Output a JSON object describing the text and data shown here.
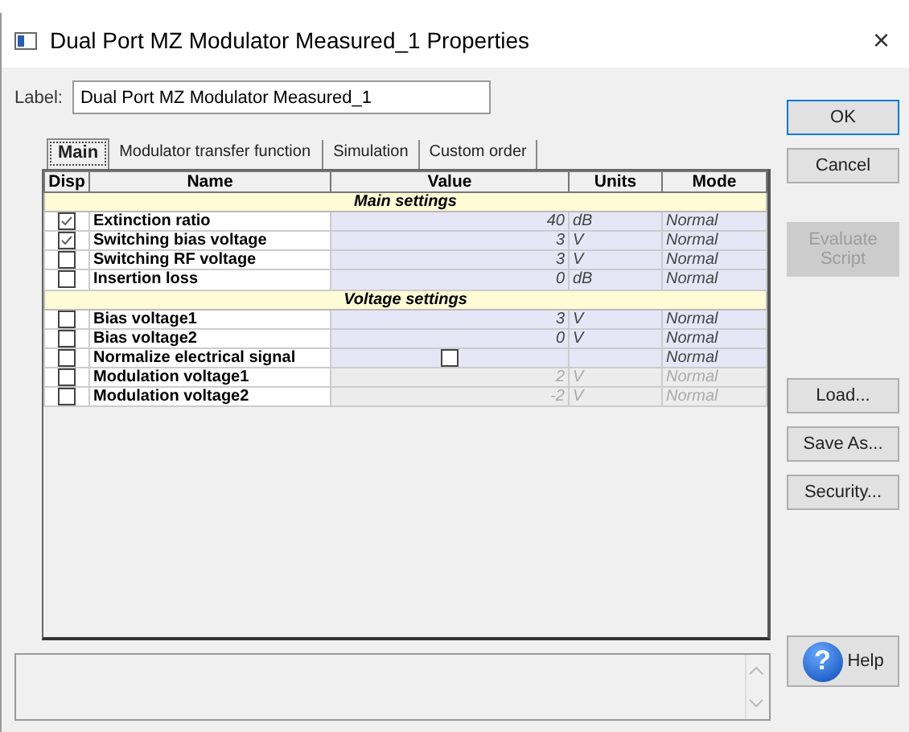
{
  "window": {
    "title": "Dual Port MZ Modulator Measured_1 Properties",
    "close": "×"
  },
  "label": {
    "caption": "Label:",
    "value": "Dual Port MZ Modulator Measured_1"
  },
  "tabs": [
    {
      "label": "Main",
      "selected": true
    },
    {
      "label": "Modulator transfer function",
      "selected": false
    },
    {
      "label": "Simulation",
      "selected": false
    },
    {
      "label": "Custom order",
      "selected": false
    }
  ],
  "table": {
    "columns": [
      "Disp",
      "Name",
      "Value",
      "Units",
      "Mode"
    ],
    "rows": [
      {
        "kind": "section",
        "title": "Main settings"
      },
      {
        "kind": "param",
        "checked": true,
        "name": "Extinction ratio",
        "value": "40",
        "units": "dB",
        "mode": "Normal",
        "disabled": false
      },
      {
        "kind": "param",
        "checked": true,
        "name": "Switching bias voltage",
        "value": "3",
        "units": "V",
        "mode": "Normal",
        "disabled": false
      },
      {
        "kind": "param",
        "checked": false,
        "name": "Switching RF voltage",
        "value": "3",
        "units": "V",
        "mode": "Normal",
        "disabled": false
      },
      {
        "kind": "param",
        "checked": false,
        "name": "Insertion loss",
        "value": "0",
        "units": "dB",
        "mode": "Normal",
        "disabled": false
      },
      {
        "kind": "section",
        "title": "Voltage settings"
      },
      {
        "kind": "param",
        "checked": false,
        "name": "Bias voltage1",
        "value": "3",
        "units": "V",
        "mode": "Normal",
        "disabled": false
      },
      {
        "kind": "param",
        "checked": false,
        "name": "Bias voltage2",
        "value": "0",
        "units": "V",
        "mode": "Normal",
        "disabled": false
      },
      {
        "kind": "bool",
        "checked": false,
        "name": "Normalize electrical signal",
        "value_checked": false,
        "mode": "Normal",
        "disabled": false
      },
      {
        "kind": "param",
        "checked": false,
        "name": "Modulation voltage1",
        "value": "2",
        "units": "V",
        "mode": "Normal",
        "disabled": true
      },
      {
        "kind": "param",
        "checked": false,
        "name": "Modulation voltage2",
        "value": "-2",
        "units": "V",
        "mode": "Normal",
        "disabled": true
      }
    ]
  },
  "buttons": [
    {
      "label": "OK",
      "disabled": false,
      "default": true
    },
    {
      "label": "Cancel",
      "disabled": false,
      "default": false
    },
    {
      "label": "Evaluate Script",
      "disabled": true,
      "default": false
    },
    {
      "label": "Load...",
      "disabled": false,
      "default": false
    },
    {
      "label": "Save As...",
      "disabled": false,
      "default": false
    },
    {
      "label": "Security...",
      "disabled": false,
      "default": false
    }
  ],
  "help": {
    "label": "Help",
    "glyph": "?"
  }
}
